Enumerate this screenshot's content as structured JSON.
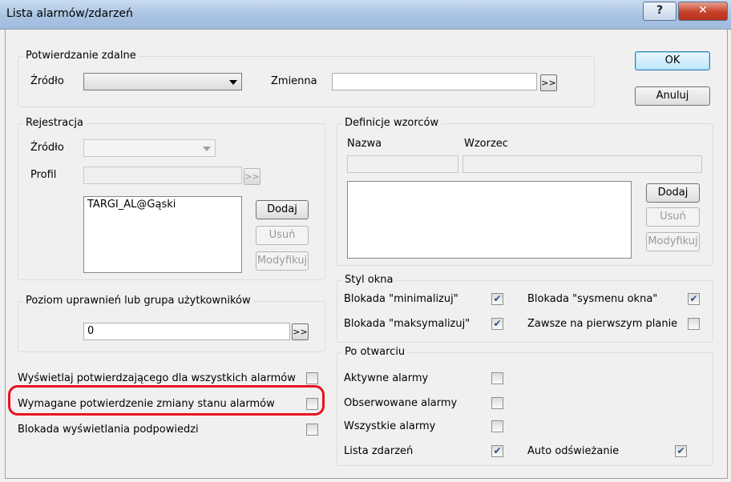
{
  "window": {
    "title": "Lista alarmów/zdarzeń",
    "help": "?",
    "close": "✕"
  },
  "buttons": {
    "ok": "OK",
    "cancel": "Anuluj"
  },
  "potwierdzanie": {
    "legend": "Potwierdzanie zdalne",
    "source_label": "Źródło",
    "source_value": "",
    "variable_label": "Zmienna",
    "variable_value": "",
    "browse": ">>"
  },
  "rejestracja": {
    "legend": "Rejestracja",
    "source_label": "Źródło",
    "profile_label": "Profil",
    "browse": ">>",
    "list_items": [
      "TARGI_AL@Gąski"
    ],
    "add": "Dodaj",
    "remove": "Usuń",
    "modify": "Modyfikuj"
  },
  "definicje": {
    "legend": "Definicje wzorców",
    "name_header": "Nazwa",
    "pattern_header": "Wzorzec",
    "add": "Dodaj",
    "remove": "Usuń",
    "modify": "Modyfikuj"
  },
  "poziom": {
    "legend": "Poziom uprawnień lub grupa użytkowników",
    "value": "0",
    "browse": ">>"
  },
  "styl_okna": {
    "legend": "Styl okna",
    "minimize_label": "Blokada \"minimalizuj\"",
    "minimize_checked": true,
    "maximize_label": "Blokada \"maksymalizuj\"",
    "maximize_checked": true,
    "sysmenu_label": "Blokada \"sysmenu okna\"",
    "sysmenu_checked": true,
    "ontop_label": "Zawsze na pierwszym planie",
    "ontop_checked": false
  },
  "po_otwarciu": {
    "legend": "Po otwarciu",
    "active_label": "Aktywne alarmy",
    "active_checked": false,
    "observed_label": "Obserwowane alarmy",
    "observed_checked": false,
    "all_label": "Wszystkie alarmy",
    "all_checked": false,
    "events_label": "Lista zdarzeń",
    "events_checked": true,
    "autorefresh_label": "Auto odświeżanie",
    "autorefresh_checked": true
  },
  "options": {
    "show_confirming_label": "Wyświetlaj potwierdzającego dla wszystkich alarmów",
    "show_confirming_checked": false,
    "require_confirm_label": "Wymagane potwierdzenie zmiany stanu alarmów",
    "require_confirm_checked": false,
    "block_tooltips_label": "Blokada wyświetlania podpowiedzi",
    "block_tooltips_checked": false
  },
  "colors": {
    "highlight": "#e8131e",
    "titlebar": "#a9c3e2",
    "close": "#c6402a"
  }
}
